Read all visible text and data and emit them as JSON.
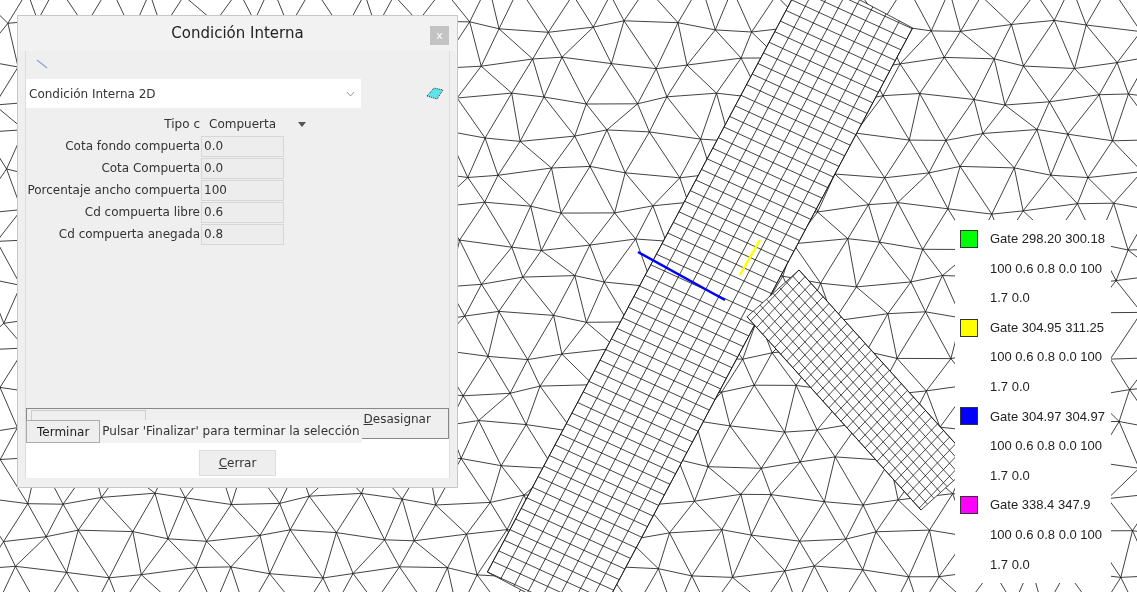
{
  "dialog": {
    "title": "Condición Interna",
    "close": "x",
    "condition_select": {
      "value": "Condición Interna 2D"
    },
    "type_row": {
      "label": "Tipo c",
      "value": "Compuerta"
    },
    "fields": [
      {
        "label": "Cota fondo compuerta",
        "value": "0.0"
      },
      {
        "label": "Cota Compuerta",
        "value": "0.0"
      },
      {
        "label": "Porcentaje ancho compuerta",
        "value": "100"
      },
      {
        "label": "Cd compuerta libre",
        "value": "0.6"
      },
      {
        "label": "Cd compuerta anegada",
        "value": "0.8"
      }
    ],
    "finish_button": "Terminar",
    "status_text": "Pulsar 'Finalizar' para terminar la selección",
    "unassign_button": "Desasignar",
    "close_button": "Cerrar"
  },
  "legend": [
    {
      "color": "#00ff00",
      "lines": [
        "Gate 298.20 300.18",
        "100 0.6 0.8 0.0 100",
        "1.7 0.0"
      ]
    },
    {
      "color": "#ffff00",
      "lines": [
        "Gate 304.95 311.25",
        "100 0.6 0.8 0.0 100",
        "1.7 0.0"
      ]
    },
    {
      "color": "#0000ff",
      "lines": [
        "Gate 304.97 304.97",
        "100 0.6 0.8 0.0 100",
        "1.7 0.0"
      ]
    },
    {
      "color": "#ff00ff",
      "lines": [
        "Gate 338.4 347.9",
        "100 0.6 0.8 0.0 100",
        "1.7 0.0"
      ]
    }
  ]
}
